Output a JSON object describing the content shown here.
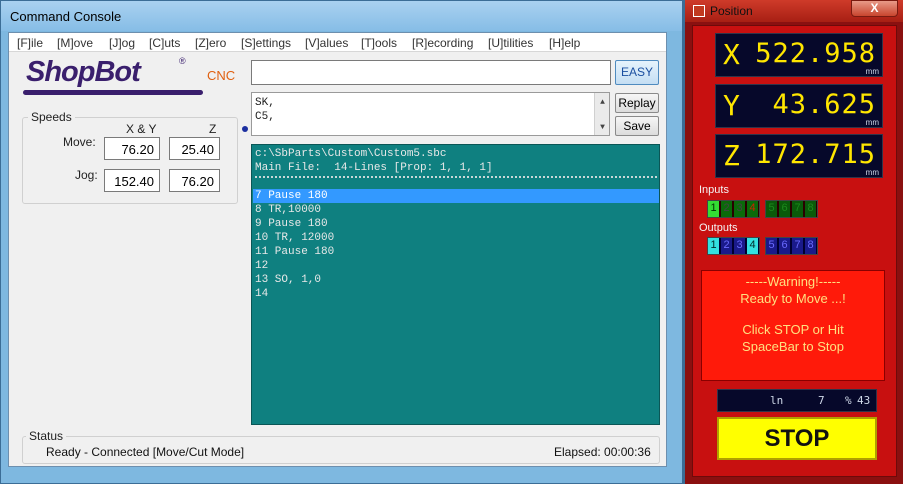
{
  "console": {
    "title": "Command Console",
    "menu": [
      "[F]ile",
      "[M]ove",
      "[J]og",
      "[C]uts",
      "[Z]ero",
      "[S]ettings",
      "[V]alues",
      "[T]ools",
      "[R]ecording",
      "[U]tilities",
      "[H]elp"
    ],
    "logo": {
      "brand": "ShopBot",
      "registered": "®",
      "tag": "CNC"
    },
    "speeds": {
      "group_label": "Speeds",
      "col_xy": "X & Y",
      "col_z": "Z",
      "move_label": "Move:",
      "jog_label": "Jog:",
      "move_xy": "76.20",
      "move_z": "25.40",
      "jog_xy": "152.40",
      "jog_z": "76.20"
    },
    "command_input": {
      "value": ""
    },
    "easy_label": "EASY",
    "replay_label": "Replay",
    "save_label": "Save",
    "history": [
      "SK,",
      "C5,"
    ],
    "program": {
      "header": [
        "c:\\SbParts\\Custom\\Custom5.sbc",
        "Main File:  14-Lines [Prop: 1, 1, 1]"
      ],
      "lines": [
        "7 Pause 180",
        "8 TR,10000",
        "9 Pause 180",
        "10 TR, 12000",
        "11 Pause 180",
        "12",
        "13 SO, 1,0",
        "14"
      ],
      "selected_index": 0
    },
    "status": {
      "group_label": "Status",
      "text": "Ready - Connected  [Move/Cut Mode]",
      "elapsed": "Elapsed: 00:00:36"
    }
  },
  "position": {
    "title": "Position",
    "close_symbol": "X",
    "axes": [
      {
        "letter": "X",
        "value": "522.958",
        "unit": "mm"
      },
      {
        "letter": "Y",
        "value": "43.625",
        "unit": "mm"
      },
      {
        "letter": "Z",
        "value": "172.715",
        "unit": "mm"
      }
    ],
    "inputs_label": "Inputs",
    "inputs": [
      "1",
      "2",
      "3",
      "4",
      "5",
      "6",
      "7",
      "8"
    ],
    "inputs_on": [
      true,
      false,
      false,
      false,
      false,
      false,
      false,
      false
    ],
    "outputs_label": "Outputs",
    "outputs": [
      "1",
      "2",
      "3",
      "4",
      "5",
      "6",
      "7",
      "8"
    ],
    "outputs_on": [
      true,
      false,
      false,
      true,
      false,
      false,
      false,
      false
    ],
    "warning": [
      "-----Warning!-----",
      "Ready to Move ...!",
      "Click STOP or Hit",
      "SpaceBar to Stop"
    ],
    "line_label": "ln",
    "line_number": "7",
    "percent_label": "%",
    "percent": "43",
    "stop_label": "STOP",
    "colors": {
      "accent_yellow": "#ffff00",
      "panel_red": "#c81010",
      "display_bg": "#06082a",
      "program_bg": "#0f8080",
      "highlight": "#3399ff"
    }
  }
}
